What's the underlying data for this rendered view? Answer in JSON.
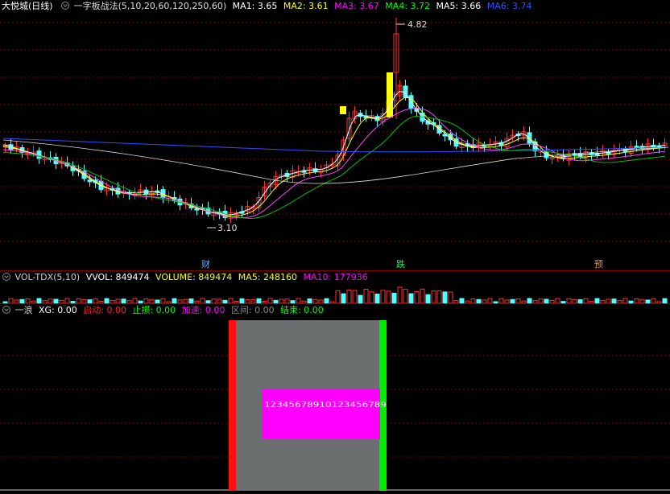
{
  "main_header": {
    "stock": "大悦城(日线)",
    "strategy": "一字板战法(5,10,20,60,120,250,60)",
    "ma": [
      {
        "label": "MA1: 3.65",
        "color": "#ffffff"
      },
      {
        "label": "MA2: 3.61",
        "color": "#ffff00"
      },
      {
        "label": "MA3: 3.67",
        "color": "#ff00ff"
      },
      {
        "label": "MA4: 3.72",
        "color": "#00ff00"
      },
      {
        "label": "MA5: 3.66",
        "color": "#ffffff"
      },
      {
        "label": "MA6: 3.74",
        "color": "#3050ff"
      }
    ]
  },
  "price_labels": {
    "high": "4.82",
    "low": "3.10"
  },
  "events": [
    {
      "label": "财",
      "color": "#6aa8ff"
    },
    {
      "label": "跌",
      "color": "#00ff60"
    },
    {
      "label": "预",
      "color": "#ff9020"
    }
  ],
  "vol_header": [
    {
      "label": "VOL-TDX(5,10)",
      "color": "#cccccc"
    },
    {
      "label": "VVOL: 849474",
      "color": "#ffffff"
    },
    {
      "label": "VOLUME: 849474",
      "color": "#ffff00"
    },
    {
      "label": "MA5: 248160",
      "color": "#ffff00"
    },
    {
      "label": "MA10: 177936",
      "color": "#ff00ff"
    }
  ],
  "ind_header": [
    {
      "label": "一浪",
      "color": "#cccccc"
    },
    {
      "label": "XG: 0.00",
      "color": "#ffffff"
    },
    {
      "label": "启动: 0.00",
      "color": "#ff2020"
    },
    {
      "label": "止损: 0.00",
      "color": "#00ff00"
    },
    {
      "label": "加速: 0.00",
      "color": "#ff00ff"
    },
    {
      "label": "区间: 0.00",
      "color": "#888888"
    },
    {
      "label": "结束: 0.00",
      "color": "#00ff00"
    }
  ],
  "indicator_text": "12345678910123456789"
}
